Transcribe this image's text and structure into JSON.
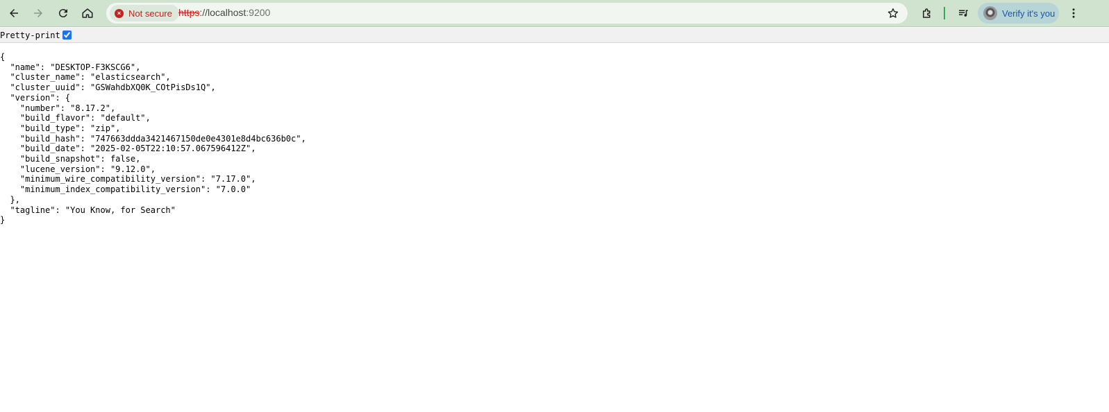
{
  "browser": {
    "security_label": "Not secure",
    "url_scheme": "https",
    "url_separator": "://",
    "url_host": "localhost",
    "url_port": ":9200",
    "profile_label": "Verify it's you",
    "accent_color": "#cfe3cf",
    "warning_color": "#c5221f"
  },
  "toolbar_icons": [
    "back-arrow-icon",
    "forward-arrow-icon",
    "reload-icon",
    "home-icon",
    "star-icon",
    "extensions-icon",
    "media-controls-icon",
    "avatar-icon",
    "more-vert-icon"
  ],
  "pretty_print": {
    "label": "Pretty-print",
    "checked": true
  },
  "json_lines": [
    "{",
    "  \"name\": \"DESKTOP-F3KSCG6\",",
    "  \"cluster_name\": \"elasticsearch\",",
    "  \"cluster_uuid\": \"GSWahdbXQ0K_COtPisDs1Q\",",
    "  \"version\": {",
    "    \"number\": \"8.17.2\",",
    "    \"build_flavor\": \"default\",",
    "    \"build_type\": \"zip\",",
    "    \"build_hash\": \"747663ddda3421467150de0e4301e8d4bc636b0c\",",
    "    \"build_date\": \"2025-02-05T22:10:57.067596412Z\",",
    "    \"build_snapshot\": false,",
    "    \"lucene_version\": \"9.12.0\",",
    "    \"minimum_wire_compatibility_version\": \"7.17.0\",",
    "    \"minimum_index_compatibility_version\": \"7.0.0\"",
    "  },",
    "  \"tagline\": \"You Know, for Search\"",
    "}"
  ]
}
